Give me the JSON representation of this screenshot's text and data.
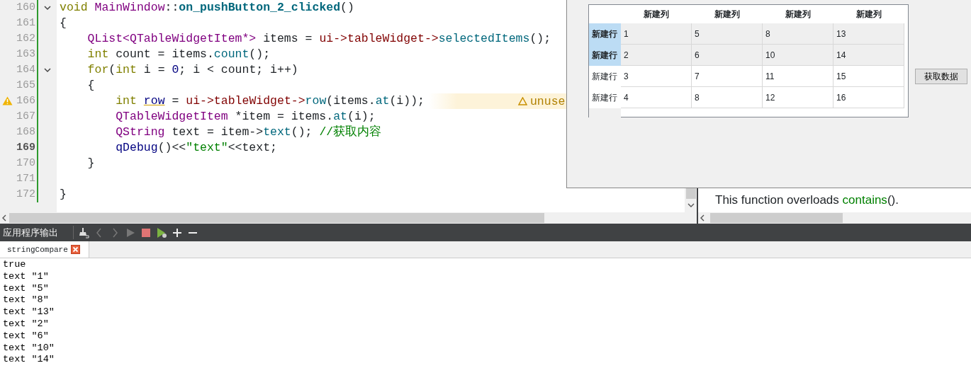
{
  "editor": {
    "lines": [
      {
        "number": "160",
        "fold": true,
        "current": false,
        "warning": false,
        "tokens": [
          {
            "kind": "keyword",
            "text": "void"
          },
          {
            "kind": "type",
            "text": " MainWindow"
          },
          {
            "kind": "plain",
            "text": "::"
          },
          {
            "kind": "function_def",
            "text": "on_pushButton_2_clicked"
          },
          {
            "kind": "plain",
            "text": "()"
          }
        ]
      },
      {
        "number": "161",
        "fold": false,
        "current": false,
        "warning": false,
        "tokens": [
          {
            "kind": "plain",
            "text": "{"
          }
        ]
      },
      {
        "number": "162",
        "fold": false,
        "current": false,
        "warning": false,
        "tokens": [
          {
            "kind": "type",
            "text": "    QList<QTableWidgetItem*>"
          },
          {
            "kind": "plain",
            "text": " items = "
          },
          {
            "kind": "member",
            "text": "ui->tableWidget->"
          },
          {
            "kind": "method",
            "text": "selectedItems"
          },
          {
            "kind": "plain",
            "text": "();"
          }
        ]
      },
      {
        "number": "163",
        "fold": false,
        "current": false,
        "warning": false,
        "tokens": [
          {
            "kind": "keyword",
            "text": "    int"
          },
          {
            "kind": "plain",
            "text": " count = items."
          },
          {
            "kind": "method",
            "text": "count"
          },
          {
            "kind": "plain",
            "text": "();"
          }
        ]
      },
      {
        "number": "164",
        "fold": true,
        "current": false,
        "warning": false,
        "tokens": [
          {
            "kind": "keyword",
            "text": "    for"
          },
          {
            "kind": "plain",
            "text": "("
          },
          {
            "kind": "keyword",
            "text": "int"
          },
          {
            "kind": "plain",
            "text": " i = "
          },
          {
            "kind": "number",
            "text": "0"
          },
          {
            "kind": "plain",
            "text": "; i < count; i++)"
          }
        ]
      },
      {
        "number": "165",
        "fold": false,
        "current": false,
        "warning": false,
        "tokens": [
          {
            "kind": "plain",
            "text": "    {"
          }
        ]
      },
      {
        "number": "166",
        "fold": false,
        "current": false,
        "warning": true,
        "annotation": "unuse",
        "tokens": [
          {
            "kind": "keyword",
            "text": "        int "
          },
          {
            "kind": "unused",
            "text": "row"
          },
          {
            "kind": "plain",
            "text": " = "
          },
          {
            "kind": "member",
            "text": "ui->tableWidget->"
          },
          {
            "kind": "method",
            "text": "row"
          },
          {
            "kind": "plain",
            "text": "(items."
          },
          {
            "kind": "method",
            "text": "at"
          },
          {
            "kind": "plain",
            "text": "(i));"
          }
        ]
      },
      {
        "number": "167",
        "fold": false,
        "current": false,
        "warning": false,
        "tokens": [
          {
            "kind": "type",
            "text": "        QTableWidgetItem"
          },
          {
            "kind": "plain",
            "text": " *item = items."
          },
          {
            "kind": "method",
            "text": "at"
          },
          {
            "kind": "plain",
            "text": "(i);"
          }
        ]
      },
      {
        "number": "168",
        "fold": false,
        "current": false,
        "warning": false,
        "tokens": [
          {
            "kind": "type",
            "text": "        QString"
          },
          {
            "kind": "plain",
            "text": " text = item->"
          },
          {
            "kind": "method",
            "text": "text"
          },
          {
            "kind": "plain",
            "text": "(); "
          },
          {
            "kind": "comment",
            "text": "//获取内容"
          }
        ]
      },
      {
        "number": "169",
        "fold": false,
        "current": true,
        "warning": false,
        "tokens": [
          {
            "kind": "call",
            "text": "        qDebug"
          },
          {
            "kind": "plain",
            "text": "()<<"
          },
          {
            "kind": "string",
            "text": "\"text\""
          },
          {
            "kind": "plain",
            "text": "<<text;"
          }
        ]
      },
      {
        "number": "170",
        "fold": false,
        "current": false,
        "warning": false,
        "tokens": [
          {
            "kind": "plain",
            "text": "    }"
          }
        ]
      },
      {
        "number": "171",
        "fold": false,
        "current": false,
        "warning": false
      },
      {
        "number": "172",
        "fold": false,
        "current": false,
        "warning": false,
        "tokens": [
          {
            "kind": "plain",
            "text": "}"
          }
        ]
      }
    ]
  },
  "help": {
    "before": "This function overloads ",
    "link": "contains",
    "after": "()."
  },
  "dialog": {
    "table": {
      "columns": [
        "新建列",
        "新建列",
        "新建列",
        "新建列"
      ],
      "rows": [
        {
          "header": "新建行",
          "selected": true,
          "cells": [
            "1",
            "5",
            "8",
            "13"
          ]
        },
        {
          "header": "新建行",
          "selected": true,
          "cells": [
            "2",
            "6",
            "10",
            "14"
          ]
        },
        {
          "header": "新建行",
          "selected": false,
          "cells": [
            "3",
            "7",
            "11",
            "15"
          ]
        },
        {
          "header": "新建行",
          "selected": false,
          "cells": [
            "4",
            "8",
            "12",
            "16"
          ]
        }
      ]
    },
    "button": "获取数据"
  },
  "output": {
    "title": "应用程序输出",
    "tab": "stringCompare",
    "lines": [
      "true",
      "text \"1\"",
      "text \"5\"",
      "text \"8\"",
      "text \"13\"",
      "text \"2\"",
      "text \"6\"",
      "text \"10\"",
      "text \"14\""
    ]
  }
}
